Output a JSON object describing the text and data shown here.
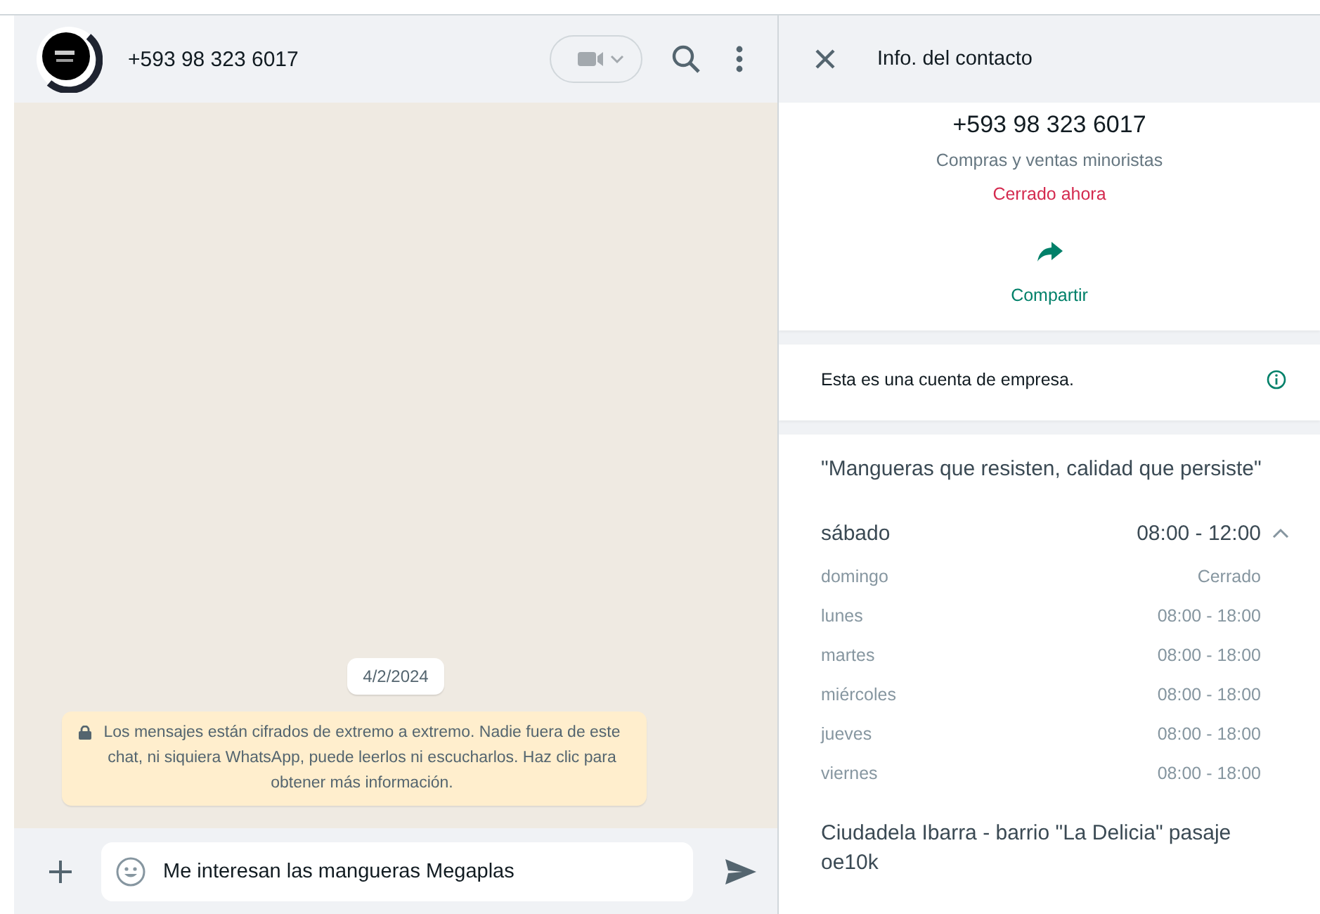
{
  "chat": {
    "contact": "+593 98 323 6017",
    "date": "4/2/2024",
    "notice": "Los mensajes están cifrados de extremo a extremo. Nadie fuera de este chat, ni siquiera WhatsApp, puede leerlos ni escucharlos. Haz clic para obtener más información.",
    "message_input": {
      "value": "Me interesan las mangueras Megaplas"
    }
  },
  "info": {
    "title": "Info. del contacto",
    "phone": "+593 98 323 6017",
    "category": "Compras y ventas minoristas",
    "status": "Cerrado ahora",
    "share": "Compartir",
    "business_note": "Esta es una cuenta de empresa.",
    "description": "\"Mangueras que resisten, calidad que persiste\"",
    "hours_expanded": true,
    "hours": [
      {
        "day": "sábado",
        "time": "08:00 - 12:00",
        "today": true
      },
      {
        "day": "domingo",
        "time": "Cerrado",
        "today": false
      },
      {
        "day": "lunes",
        "time": "08:00 - 18:00",
        "today": false
      },
      {
        "day": "martes",
        "time": "08:00 - 18:00",
        "today": false
      },
      {
        "day": "miércoles",
        "time": "08:00 - 18:00",
        "today": false
      },
      {
        "day": "jueves",
        "time": "08:00 - 18:00",
        "today": false
      },
      {
        "day": "viernes",
        "time": "08:00 - 18:00",
        "today": false
      }
    ],
    "address": "Ciudadela Ibarra - barrio \"La Delicia\" pasaje oe10k"
  }
}
